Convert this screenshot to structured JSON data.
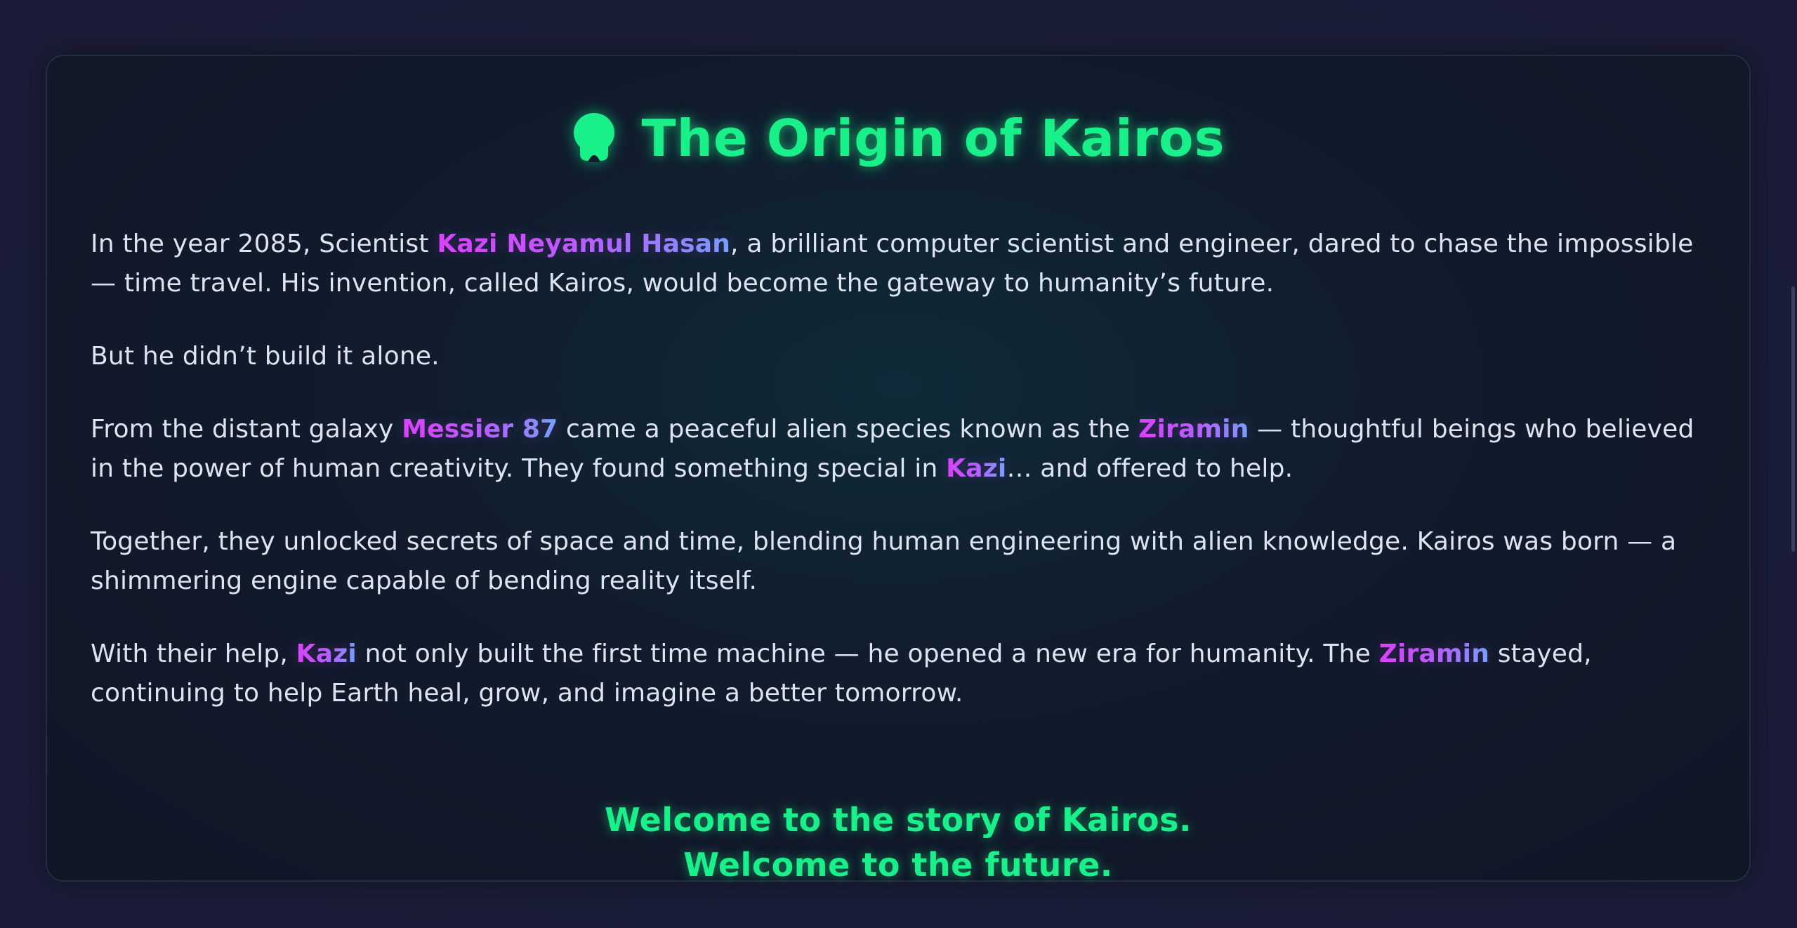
{
  "header": {
    "title": "The Origin of Kairos",
    "icon": "brain-icon",
    "accent_color": "#19f08a"
  },
  "story": {
    "p1": {
      "before": "In the year 2085, Scientist ",
      "name": "Kazi Neyamul Hasan",
      "after": ", a brilliant computer scientist and engineer, dared to chase the impossible — time travel. His invention, called Kairos, would become the gateway to humanity’s future."
    },
    "p2": {
      "text": "But he didn’t build it alone."
    },
    "p3": {
      "before": "From the distant galaxy ",
      "galaxy": "Messier 87",
      "middle": " came a peaceful alien species known as the ",
      "species": "Ziramin",
      "middle2": " — thoughtful beings who believed in the power of human creativity. They found something special in ",
      "name": "Kazi",
      "after": "… and offered to help."
    },
    "p4": {
      "text": "Together, they unlocked secrets of space and time, blending human engineering with alien knowledge. Kairos was born — a shimmering engine capable of bending reality itself."
    },
    "p5": {
      "before": "With their help, ",
      "name": "Kazi",
      "middle": " not only built the first time machine — he opened a new era for humanity. The ",
      "species": "Ziramin",
      "after": " stayed, continuing to help Earth heal, grow, and imagine a better tomorrow."
    }
  },
  "closing": {
    "line1": "Welcome to the story of Kairos.",
    "line2": "Welcome to the future."
  },
  "colors": {
    "highlight_start": "#e040fb",
    "highlight_end": "#6fa8ff",
    "body_text": "#dde4ef"
  }
}
